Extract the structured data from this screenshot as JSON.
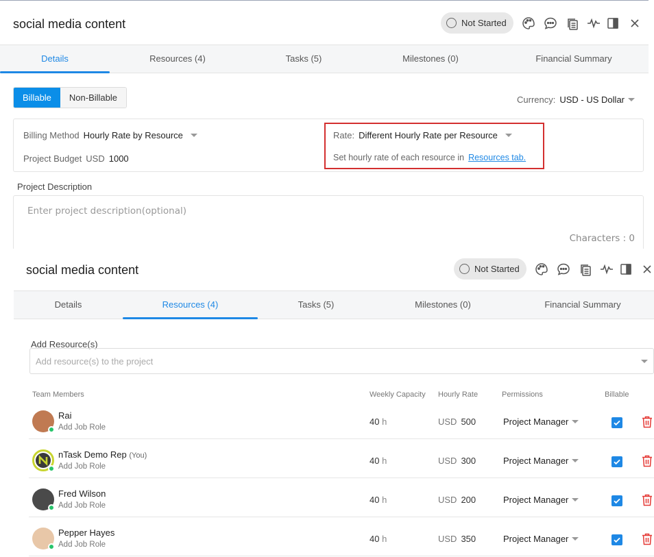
{
  "top_panel": {
    "title": "social media content",
    "status": "Not Started",
    "tabs": [
      "Details",
      "Resources (4)",
      "Tasks (5)",
      "Milestones (0)",
      "Financial Summary"
    ],
    "active_tab": "Details",
    "billing_toggle": {
      "billable": "Billable",
      "non_billable": "Non-Billable"
    },
    "currency_label": "Currency:",
    "currency_value": "USD - US Dollar",
    "billing_method_label": "Billing Method",
    "billing_method_value": "Hourly Rate by Resource",
    "project_budget_label": "Project Budget",
    "project_budget_currency": "USD",
    "project_budget_value": "1000",
    "rate_label": "Rate:",
    "rate_value": "Different Hourly Rate per Resource",
    "rate_hint": "Set hourly rate of each resource in",
    "rate_hint_link": "Resources tab.",
    "description_label": "Project Description",
    "description_placeholder": "Enter project description(optional)",
    "characters_label": "Characters : 0"
  },
  "bottom_panel": {
    "title": "social media content",
    "status": "Not Started",
    "tabs": [
      "Details",
      "Resources (4)",
      "Tasks (5)",
      "Milestones (0)",
      "Financial Summary"
    ],
    "active_tab": "Resources (4)",
    "add_resource_label": "Add Resource(s)",
    "add_resource_placeholder": "Add resource(s) to the project",
    "columns": [
      "Team Members",
      "Weekly Capacity",
      "Hourly Rate",
      "Permissions",
      "Billable"
    ],
    "members": [
      {
        "name": "Rai",
        "you": "",
        "role": "Add Job Role",
        "capacity": "40",
        "unit": "h",
        "currency": "USD",
        "rate": "500",
        "permission": "Project Manager",
        "billable": true,
        "avatar_color": "#c07a52"
      },
      {
        "name": "nTask Demo Rep",
        "you": "(You)",
        "role": "Add Job Role",
        "capacity": "40",
        "unit": "h",
        "currency": "USD",
        "rate": "300",
        "permission": "Project Manager",
        "billable": true,
        "avatar_color": "#c8d530"
      },
      {
        "name": "Fred Wilson",
        "you": "",
        "role": "Add Job Role",
        "capacity": "40",
        "unit": "h",
        "currency": "USD",
        "rate": "200",
        "permission": "Project Manager",
        "billable": true,
        "avatar_color": "#4a4a4a"
      },
      {
        "name": "Pepper Hayes",
        "you": "",
        "role": "Add Job Role",
        "capacity": "40",
        "unit": "h",
        "currency": "USD",
        "rate": "350",
        "permission": "Project Manager",
        "billable": true,
        "avatar_color": "#e8c7a8"
      }
    ]
  },
  "icons": [
    "palette-icon",
    "comment-icon",
    "copy-icon",
    "activity-icon",
    "panel-icon",
    "close-icon"
  ],
  "colors": {
    "accent": "#1e88e5",
    "highlight_border": "#d32f2f",
    "online": "#27c46b",
    "delete": "#e53935"
  }
}
